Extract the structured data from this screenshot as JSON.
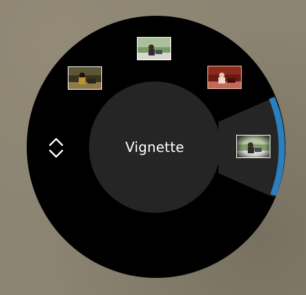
{
  "dial": {
    "selected_label": "Vignette",
    "accent_color": "#2a7fbf",
    "icons": {
      "scroll": "up-down-chevrons-icon"
    },
    "thumbnails": [
      {
        "name": "filter-preview-original"
      },
      {
        "name": "filter-preview-sepia-dark"
      },
      {
        "name": "filter-preview-warm-red"
      },
      {
        "name": "filter-preview-vignette"
      }
    ]
  }
}
